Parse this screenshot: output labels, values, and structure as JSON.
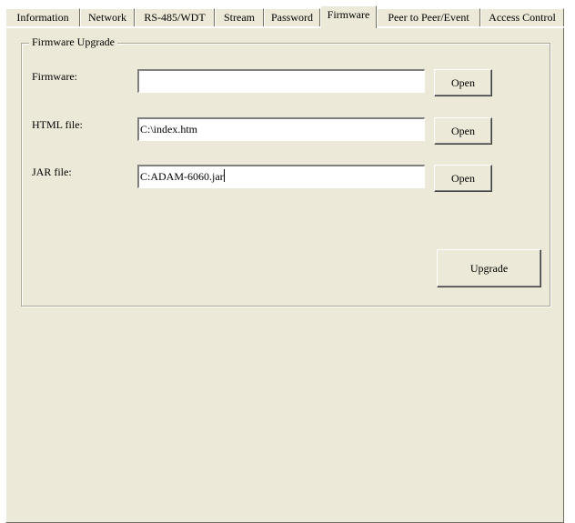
{
  "tabs": [
    {
      "label": "Information"
    },
    {
      "label": "Network"
    },
    {
      "label": "RS-485/WDT"
    },
    {
      "label": "Stream"
    },
    {
      "label": "Password"
    },
    {
      "label": "Firmware",
      "active": true
    },
    {
      "label": "Peer to Peer/Event"
    },
    {
      "label": "Access Control"
    }
  ],
  "group": {
    "title": "Firmware Upgrade"
  },
  "rows": {
    "firmware": {
      "label": "Firmware:",
      "value": "",
      "button": "Open"
    },
    "html": {
      "label": "HTML file:",
      "value": "C:\\index.htm",
      "button": "Open"
    },
    "jar": {
      "label": "JAR file:",
      "value": "C:ADAM-6060.jar",
      "button": "Open"
    }
  },
  "upgrade_button": "Upgrade",
  "colors": {
    "face": "#ece9d8",
    "shadow": "#716f64",
    "highlight": "#ffffff"
  }
}
